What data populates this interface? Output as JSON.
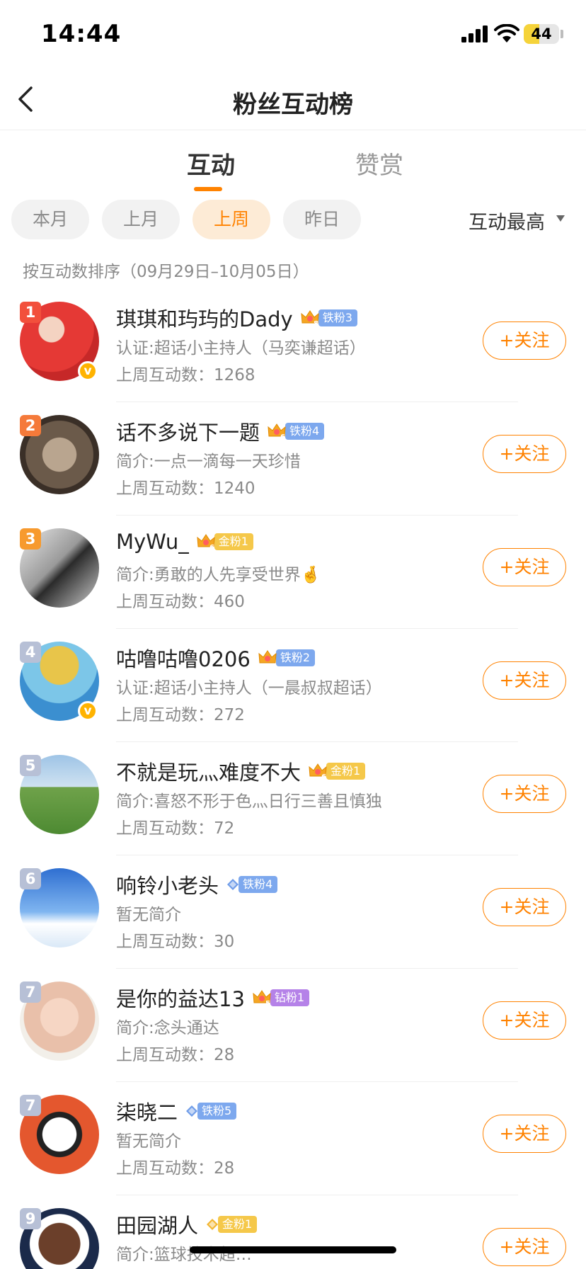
{
  "status": {
    "time": "14:44",
    "battery": "44",
    "battery_level": 0.44
  },
  "nav": {
    "title": "粉丝互动榜"
  },
  "tabs": [
    "互动",
    "赞赏"
  ],
  "filters": {
    "chips": [
      "本月",
      "上月",
      "上周",
      "昨日"
    ],
    "active": "上周",
    "sort": "互动最高"
  },
  "range_text": "按互动数排序（09月29日–10月05日）",
  "follow_label": "+关注",
  "colors": {
    "accent": "#ff8200",
    "rank1": "#f2503c",
    "rank2": "#f57a3a",
    "rank3": "#f79a2e",
    "rank_other": "#b7c0d6"
  },
  "rows": [
    {
      "rank": "1",
      "name": "琪琪和玙玙的Dady",
      "crown_level": "8",
      "badge": "铁粉3",
      "desc": "认证:超话小主持人（马奕谦超话）",
      "count": "上周互动数：1268",
      "verified": true,
      "avatar_icon": "child-photo-icon"
    },
    {
      "rank": "2",
      "name": "话不多说下一题",
      "crown_level": "6",
      "badge": "铁粉4",
      "desc": "简介:一点一滴每一天珍惜",
      "count": "上周互动数：1240",
      "verified": false,
      "avatar_icon": "dog-photo-icon"
    },
    {
      "rank": "3",
      "name": "MyWu_",
      "crown_level": "6",
      "badge": "金粉1",
      "desc": "简介:勇敢的人先享受世界🤞",
      "count": "上周互动数：460",
      "verified": false,
      "avatar_icon": "portrait-photo-icon"
    },
    {
      "rank": "4",
      "name": "咕噜咕噜0206",
      "crown_level": "",
      "badge": "铁粉2",
      "desc": "认证:超话小主持人（一晨叔叔超话）",
      "count": "上周互动数：272",
      "verified": true,
      "avatar_icon": "doll-photo-icon"
    },
    {
      "rank": "5",
      "name": "不就是玩灬难度不大",
      "crown_level": "6",
      "badge": "金粉1",
      "desc": "简介:喜怒不形于色灬日行三善且慎独",
      "count": "上周互动数：72",
      "verified": false,
      "avatar_icon": "grassland-photo-icon"
    },
    {
      "rank": "6",
      "name": "响铃小老头",
      "crown_level": "",
      "badge": "铁粉4",
      "desc": "暂无简介",
      "count": "上周互动数：30",
      "verified": false,
      "avatar_icon": "snowboard-photo-icon"
    },
    {
      "rank": "7",
      "name": "是你的益达13",
      "crown_level": "5",
      "badge": "钻粉1",
      "desc": "简介:念头通达",
      "count": "上周互动数：28",
      "verified": false,
      "avatar_icon": "baby-photo-icon"
    },
    {
      "rank": "7",
      "name": "柒晓二",
      "crown_level": "",
      "badge": "铁粉5",
      "desc": "暂无简介",
      "count": "上周互动数：28",
      "verified": false,
      "avatar_icon": "panda-mascot-icon"
    },
    {
      "rank": "9",
      "name": "田园湖人",
      "crown_level": "",
      "badge": "金粉1",
      "desc": "简介:篮球技术超…",
      "count": "",
      "verified": false,
      "avatar_icon": "basketball-player-icon"
    }
  ]
}
